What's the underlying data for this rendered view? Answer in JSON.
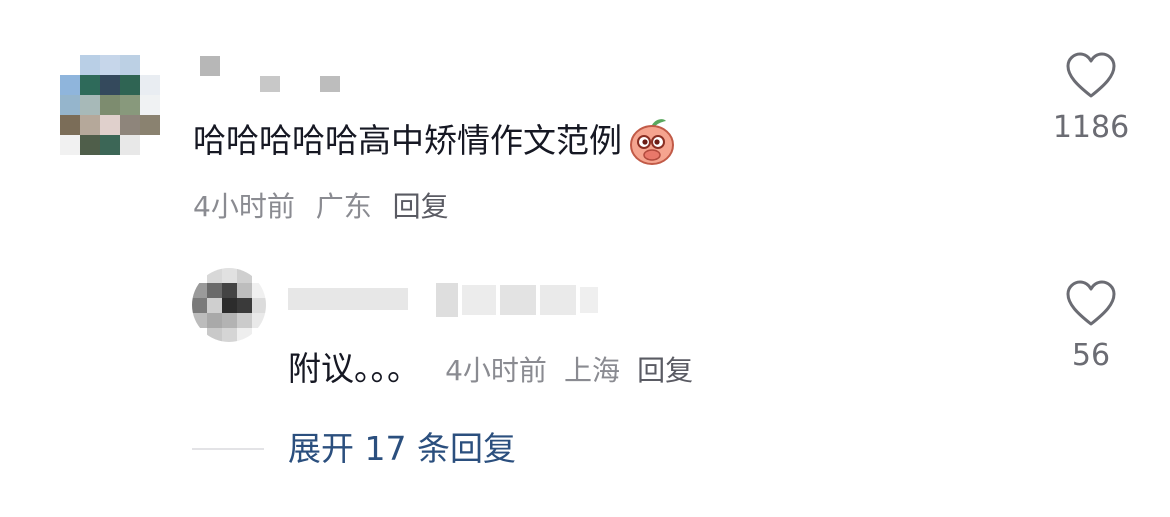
{
  "comment": {
    "text": "哈哈哈哈哈高中矫情作文范例",
    "emoji_icon": "peach-face-icon",
    "time": "4小时前",
    "location": "广东",
    "reply_label": "回复",
    "likes": "1186"
  },
  "reply": {
    "text": "附议。。。",
    "time": "4小时前",
    "location": "上海",
    "reply_label": "回复",
    "likes": "56"
  },
  "expand": {
    "label": "展开 17 条回复"
  },
  "colors": {
    "text_primary": "#161823",
    "text_secondary": "#8a8b91",
    "link_blue": "#2b4f7e",
    "like_gray": "#6b6c73"
  }
}
